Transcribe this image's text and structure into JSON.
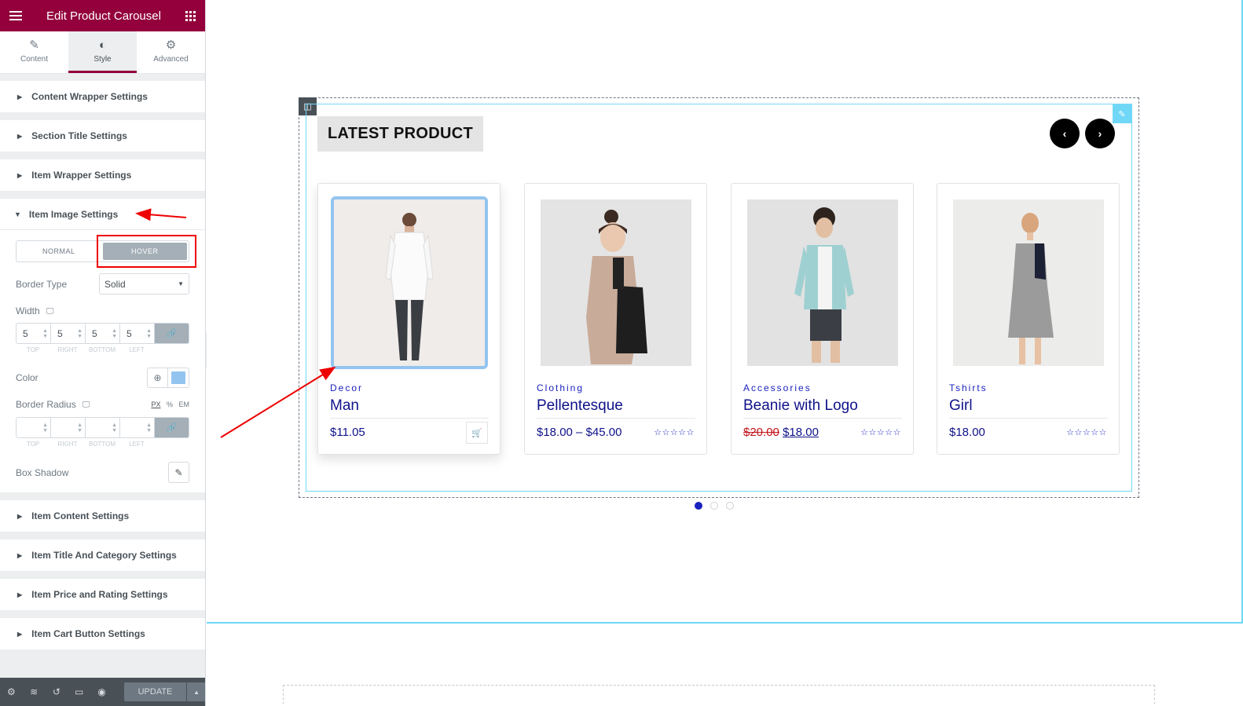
{
  "panel": {
    "title": "Edit Product Carousel",
    "tabs": [
      {
        "label": "Content",
        "icon": "pencil-icon"
      },
      {
        "label": "Style",
        "icon": "contrast-icon"
      },
      {
        "label": "Advanced",
        "icon": "gear-icon"
      }
    ],
    "sections_top": [
      "Content Wrapper Settings",
      "Section Title Settings",
      "Item Wrapper Settings"
    ],
    "open_section": {
      "title": "Item Image Settings",
      "switch": {
        "normal": "NORMAL",
        "hover": "HOVER"
      },
      "border_type": {
        "label": "Border Type",
        "value": "Solid"
      },
      "width": {
        "label": "Width",
        "values": [
          "5",
          "5",
          "5",
          "5"
        ]
      },
      "dim_labels": [
        "TOP",
        "RIGHT",
        "BOTTOM",
        "LEFT"
      ],
      "color": {
        "label": "Color",
        "swatch": "#93c4ef"
      },
      "border_radius": {
        "label": "Border Radius",
        "units": [
          "PX",
          "%",
          "EM"
        ]
      },
      "box_shadow": {
        "label": "Box Shadow"
      }
    },
    "sections_bottom": [
      "Item Content Settings",
      "Item Title And Category Settings",
      "Item Price and Rating Settings",
      "Item Cart Button Settings"
    ],
    "footer": {
      "update": "UPDATE"
    }
  },
  "carousel": {
    "title": "LATEST PRODUCT",
    "products": [
      {
        "category": "Decor",
        "name": "Man",
        "price": "$11.05",
        "has_cart": true
      },
      {
        "category": "Clothing",
        "name": "Pellentesque",
        "price": "$18.00 – $45.00",
        "rating_icon": "stars-icon"
      },
      {
        "category": "Accessories",
        "name": "Beanie with Logo",
        "old_price": "$20.00",
        "new_price": "$18.00",
        "rating_icon": "stars-icon"
      },
      {
        "category": "Tshirts",
        "name": "Girl",
        "price": "$18.00",
        "rating_icon": "stars-icon"
      }
    ],
    "dots": 3,
    "active_dot": 0
  },
  "colors": {
    "brand": "#93003c",
    "accent": "#1a22bd",
    "highlight": "#e00000"
  }
}
